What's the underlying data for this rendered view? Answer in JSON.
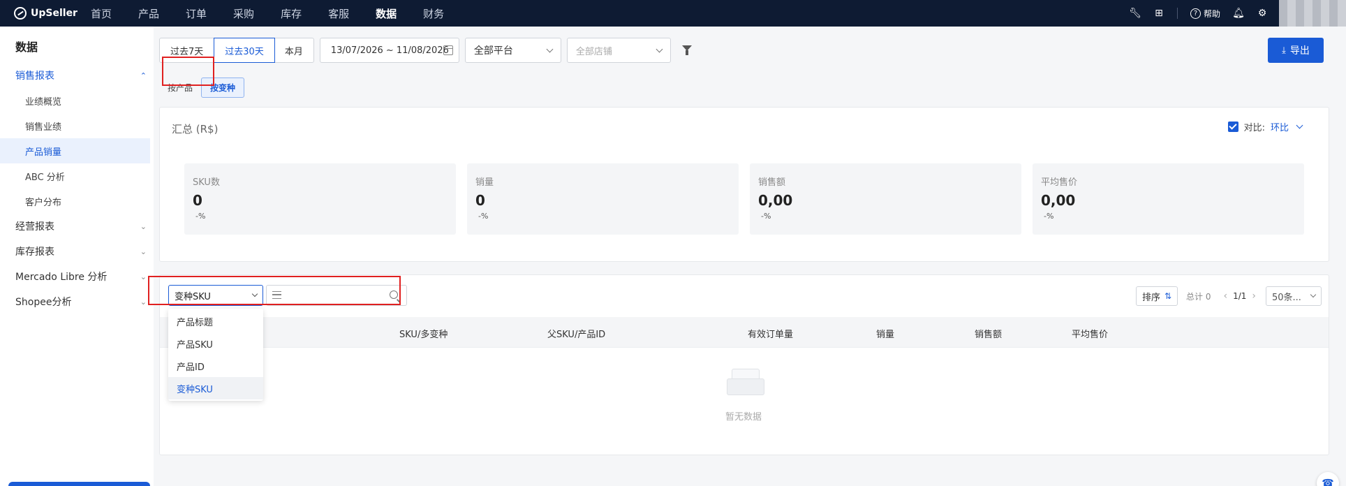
{
  "app": {
    "logo": "UpSeller"
  },
  "nav": {
    "items": [
      "首页",
      "产品",
      "订单",
      "采购",
      "库存",
      "客服",
      "数据",
      "财务"
    ],
    "active_index": 6,
    "help_label": "帮助"
  },
  "sidebar": {
    "title": "数据",
    "groups": [
      {
        "label": "销售报表",
        "open": true,
        "children": [
          "业绩概览",
          "销售业绩",
          "产品销量",
          "ABC 分析",
          "客户分布"
        ],
        "active_child": 2
      },
      {
        "label": "经营报表",
        "open": false
      },
      {
        "label": "库存报表",
        "open": false
      },
      {
        "label": "Mercado Libre 分析",
        "open": false
      },
      {
        "label": "Shopee分析",
        "open": false
      }
    ]
  },
  "filters": {
    "ranges": [
      "过去7天",
      "过去30天",
      "本月"
    ],
    "active_range": 1,
    "date_range": "13/07/2026 ~ 11/08/2026",
    "platform": "全部平台",
    "shop_placeholder": "全部店铺",
    "export_label": "导出"
  },
  "view_tabs": {
    "items": [
      "按产品",
      "按变种"
    ],
    "active_index": 1
  },
  "summary": {
    "title": "汇总 (R$)",
    "compare_label": "对比:",
    "compare_value": "环比",
    "compare_checked": true,
    "stats": [
      {
        "label": "SKU数",
        "value": "0",
        "pct": "-%"
      },
      {
        "label": "销量",
        "value": "0",
        "pct": "-%"
      },
      {
        "label": "销售额",
        "value": "0,00",
        "pct": "-%"
      },
      {
        "label": "平均售价",
        "value": "0,00",
        "pct": "-%"
      }
    ]
  },
  "table": {
    "search_field": "变种SKU",
    "search_placeholder": "",
    "field_options": [
      "产品标题",
      "产品SKU",
      "产品ID",
      "变种SKU"
    ],
    "selected_option": 3,
    "sort_label": "排序",
    "total_label": "总计 0",
    "page": "1/1",
    "page_size": "50条...",
    "columns": [
      "SKU/多变种",
      "父SKU/产品ID",
      "有效订单量",
      "销量",
      "销售额",
      "平均售价"
    ],
    "empty_text": "暂无数据"
  },
  "colors": {
    "accent": "#1a5bd6",
    "nav_bg": "#0e1b33",
    "highlight": "#e02020"
  }
}
